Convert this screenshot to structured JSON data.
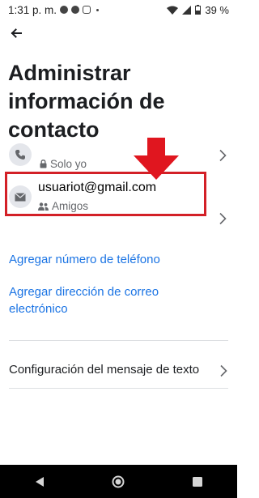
{
  "status_bar": {
    "time": "1:31 p. m.",
    "battery": "39 %",
    "icons": [
      "messenger-icon",
      "facebook-icon",
      "instagram-icon",
      "notification-dot-icon",
      "wifi-icon",
      "signal-icon",
      "battery-icon"
    ]
  },
  "header": {
    "back_icon": "back-arrow-icon",
    "title": "Administrar información de contacto"
  },
  "contacts": {
    "phone": {
      "icon": "phone-icon",
      "privacy": "Solo yo",
      "privacy_icon": "lock-icon"
    },
    "email": {
      "icon": "envelope-icon",
      "value": "usuariot@gmail.com",
      "privacy": "Amigos",
      "privacy_icon": "friends-icon"
    }
  },
  "links": {
    "add_phone": "Agregar número de teléfono",
    "add_email": "Agregar dirección de correo electrónico"
  },
  "settings": {
    "sms": "Configuración del mensaje de texto"
  },
  "annotation": {
    "highlight_color": "#d32027",
    "arrow_color": "#e0161f"
  },
  "nav_bar": {
    "buttons": [
      "back-icon",
      "home-icon",
      "recents-icon"
    ]
  }
}
